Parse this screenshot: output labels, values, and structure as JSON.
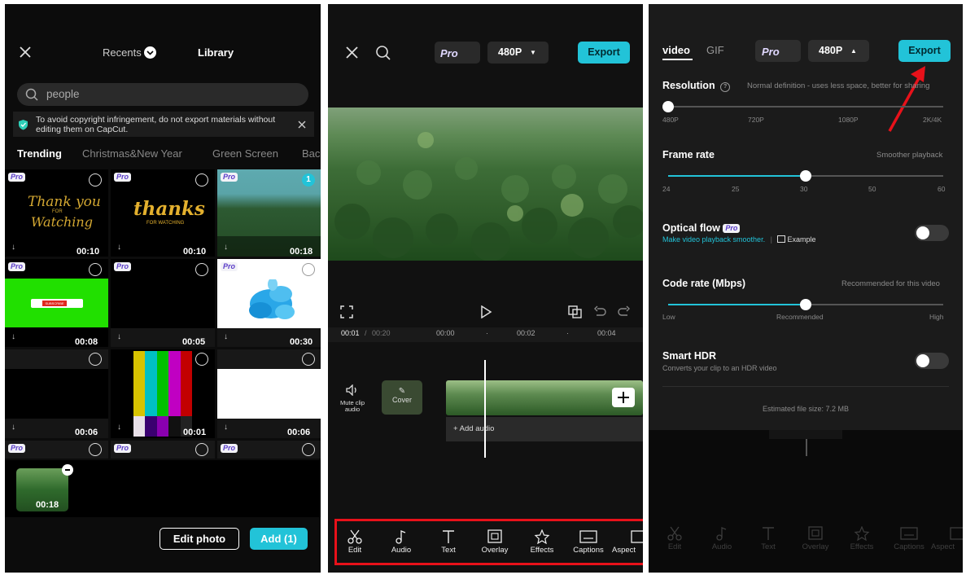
{
  "library": {
    "header": {
      "recents": "Recents",
      "library": "Library"
    },
    "search": {
      "value": "people"
    },
    "notice": "To avoid copyright infringement, do not export materials without editing them on CapCut.",
    "categories": [
      "Trending",
      "Christmas&New Year",
      "Green Screen",
      "Bac"
    ],
    "pro_badge": "Pro",
    "selected_count": "1",
    "thumbs": [
      {
        "text1": "Thank you",
        "text2": "FOR",
        "text3": "Watching",
        "duration": "00:10"
      },
      {
        "text1": "thanks",
        "text2": "FOR WATCHING",
        "duration": "00:10"
      },
      {
        "duration": "00:18"
      },
      {
        "banner": "SUBSCRIBE",
        "duration": "00:08"
      },
      {
        "duration": "00:05"
      },
      {
        "duration": "00:30"
      },
      {
        "duration": "00:06"
      },
      {
        "duration": "00:01"
      },
      {
        "duration": "00:06"
      }
    ],
    "selected_clip_duration": "00:18",
    "edit_photo": "Edit photo",
    "add_button": "Add (1)"
  },
  "editor": {
    "pro": "Pro",
    "resolution": "480P",
    "export": "Export",
    "time_current": "00:01",
    "time_total": "00:20",
    "ruler": [
      "00:00",
      "00:02",
      "00:04"
    ],
    "mute_label": "Mute clip audio",
    "cover_label": "Cover",
    "add_audio": "+ Add audio",
    "toolbar": [
      "Edit",
      "Audio",
      "Text",
      "Overlay",
      "Effects",
      "Captions",
      "Aspect"
    ]
  },
  "export_settings": {
    "tabs": [
      "video",
      "GIF"
    ],
    "pro": "Pro",
    "resolution": "480P",
    "export": "Export",
    "resolution_label": "Resolution",
    "resolution_hint": "Normal definition - uses less space, better for sharing",
    "resolution_ticks": [
      "480P",
      "720P",
      "1080P",
      "2K/4K"
    ],
    "resolution_level": 0.0,
    "frame_rate_label": "Frame rate",
    "frame_rate_hint": "Smoother playback",
    "frame_rate_ticks": [
      "24",
      "25",
      "30",
      "50",
      "60"
    ],
    "frame_rate_level": 0.5,
    "optical_flow_label": "Optical flow",
    "optical_flow_hint": "Make video playback smoother.",
    "example": "Example",
    "code_rate_label": "Code rate (Mbps)",
    "code_rate_hint": "Recommended for this video",
    "code_rate_ticks": [
      "Low",
      "Recommended",
      "High"
    ],
    "code_rate_level": 0.5,
    "smart_hdr_label": "Smart HDR",
    "smart_hdr_hint": "Converts your clip to an HDR video",
    "file_size": "Estimated file size: 7.2 MB",
    "toolbar": [
      "Edit",
      "Audio",
      "Text",
      "Overlay",
      "Effects",
      "Captions",
      "Aspect"
    ]
  },
  "colors": {
    "accent": "#22c3d8",
    "annotation_red": "#e8111a",
    "pro_text": "#5a3cc8"
  }
}
